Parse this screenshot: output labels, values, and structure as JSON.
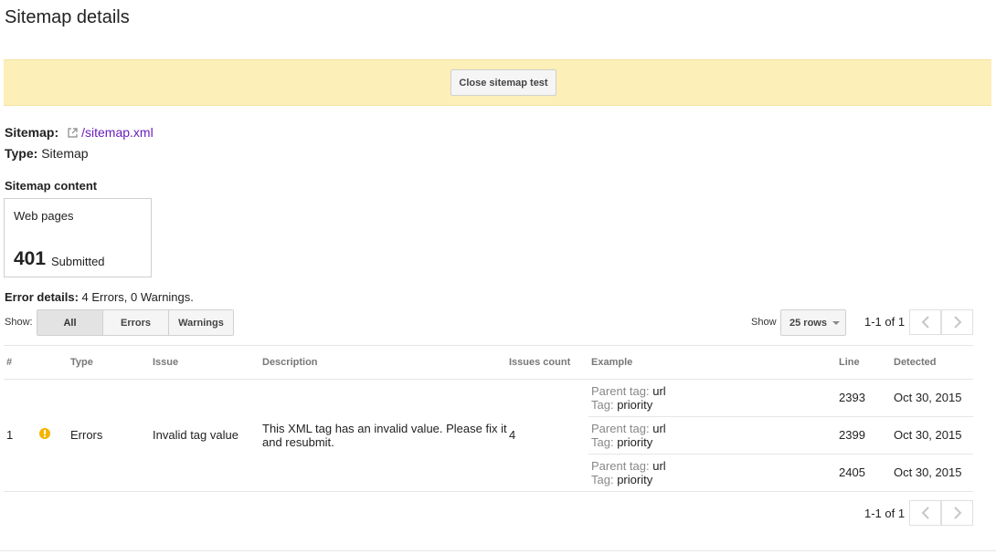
{
  "header": {
    "title": "Sitemap details"
  },
  "banner": {
    "close_label": "Close sitemap test"
  },
  "sitemap": {
    "label": "Sitemap:",
    "link": "/sitemap.xml",
    "type_label": "Type:",
    "type_value": "Sitemap"
  },
  "content": {
    "heading": "Sitemap content",
    "card_title": "Web pages",
    "count": "401",
    "count_label": "Submitted"
  },
  "errors": {
    "label": "Error details:",
    "summary": "4 Errors, 0 Warnings."
  },
  "filter": {
    "show_label": "Show:",
    "options": [
      "All",
      "Errors",
      "Warnings"
    ],
    "selected": "All"
  },
  "pagination": {
    "show_label": "Show",
    "rows_value": "25 rows",
    "range": "1-1 of 1"
  },
  "table": {
    "headers": [
      "#",
      "Type",
      "Issue",
      "Description",
      "Issues count",
      "Example",
      "Line",
      "Detected"
    ],
    "row": {
      "index": "1",
      "type": "Errors",
      "issue": "Invalid tag value",
      "description": "This XML tag has an invalid value. Please fix it and resubmit.",
      "count": "4",
      "examples": [
        {
          "parent_label": "Parent tag:",
          "parent": "url",
          "tag_label": "Tag:",
          "tag": "priority",
          "line": "2393",
          "detected": "Oct 30, 2015"
        },
        {
          "parent_label": "Parent tag:",
          "parent": "url",
          "tag_label": "Tag:",
          "tag": "priority",
          "line": "2399",
          "detected": "Oct 30, 2015"
        },
        {
          "parent_label": "Parent tag:",
          "parent": "url",
          "tag_label": "Tag:",
          "tag": "priority",
          "line": "2405",
          "detected": "Oct 30, 2015"
        }
      ]
    }
  },
  "colors": {
    "banner": "#fdefb8",
    "link": "#6a1ebb",
    "warning": "#f5b400"
  },
  "icons": {
    "external": "external-link-icon",
    "warning": "warning-icon",
    "prev": "chevron-left-icon",
    "next": "chevron-right-icon"
  }
}
